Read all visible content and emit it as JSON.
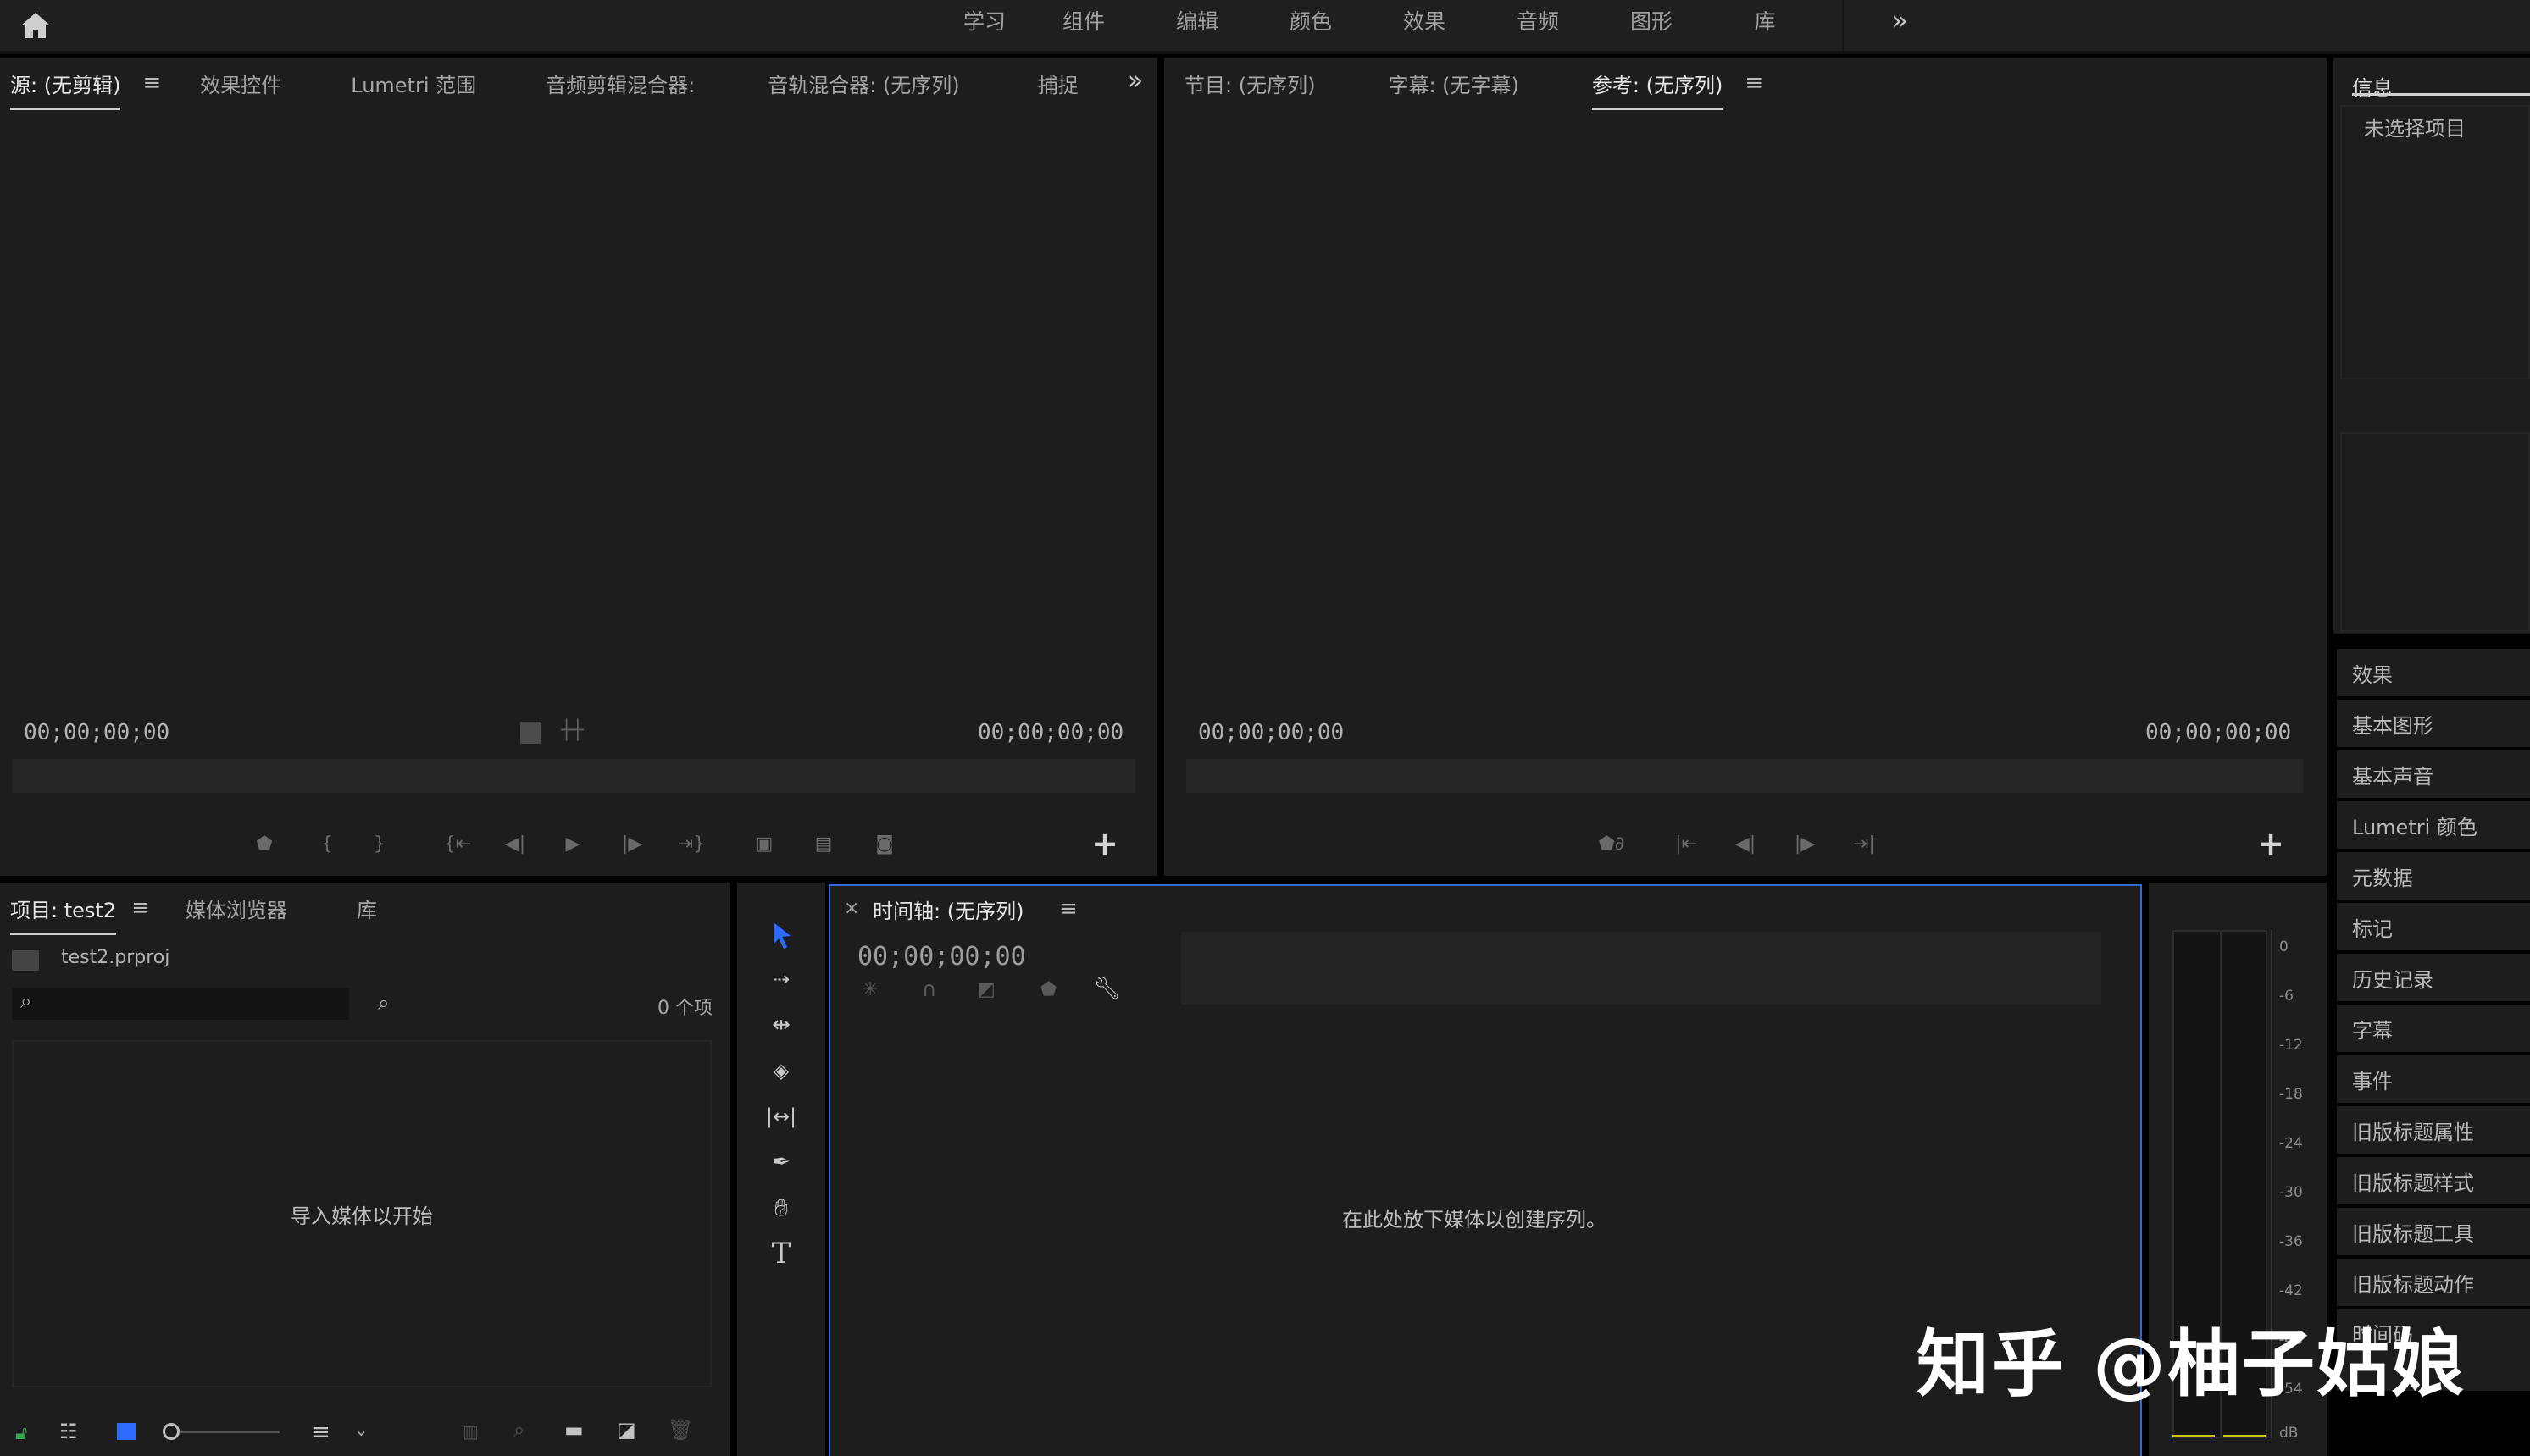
{
  "topbar": {
    "workspaces": [
      "学习",
      "组件",
      "编辑",
      "颜色",
      "效果",
      "音频",
      "图形",
      "库"
    ],
    "more": "»"
  },
  "source_panel": {
    "tabs": [
      "源: (无剪辑)",
      "效果控件",
      "Lumetri 范围",
      "音频剪辑混合器:",
      "音轨混合器: (无序列)",
      "捕捉"
    ],
    "overflow": "»",
    "timecode_left": "00;00;00;00",
    "timecode_right": "00;00;00;00",
    "add_button": "+"
  },
  "program_panel": {
    "tabs": [
      "节目: (无序列)",
      "字幕: (无字幕)",
      "参考: (无序列)"
    ],
    "timecode_left": "00;00;00;00",
    "timecode_right": "00;00;00;00",
    "add_button": "+"
  },
  "info_panel": {
    "title": "信息",
    "status": "未选择项目"
  },
  "side_items": [
    "效果",
    "基本图形",
    "基本声音",
    "Lumetri 颜色",
    "元数据",
    "标记",
    "历史记录",
    "字幕",
    "事件",
    "旧版标题属性",
    "旧版标题样式",
    "旧版标题工具",
    "旧版标题动作",
    "时间码"
  ],
  "project_panel": {
    "tabs": [
      "项目: test2",
      "媒体浏览器",
      "库"
    ],
    "file_name": "test2.prproj",
    "item_count": "0 个项",
    "search_placeholder": "",
    "empty_message": "导入媒体以开始"
  },
  "timeline_panel": {
    "close": "×",
    "title": "时间轴: (无序列)",
    "timecode": "00;00;00;00",
    "empty_message": "在此处放下媒体以创建序列。"
  },
  "audio_meter": {
    "labels": [
      "0",
      "-6",
      "-12",
      "-18",
      "-24",
      "-30",
      "-36",
      "-42",
      "-48",
      "-54",
      "dB"
    ]
  },
  "watermark": "知乎 @柚子姑娘",
  "colors": {
    "background": "#000000",
    "panel": "#1d1d1d",
    "accent_blue": "#2d6bff",
    "timeline_border": "#3569d8",
    "lock_green": "#3aa64a"
  }
}
